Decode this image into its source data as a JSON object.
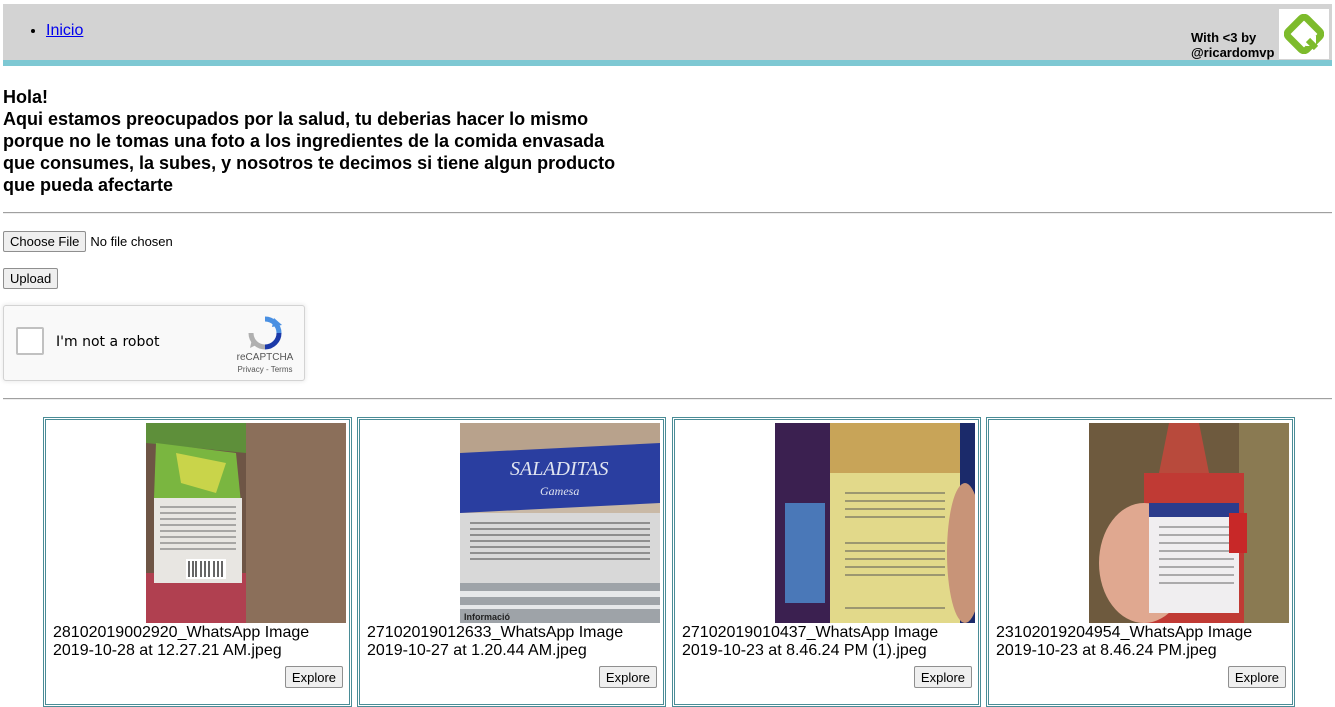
{
  "nav": {
    "home_label": "Inicio"
  },
  "credit": {
    "line1": "With <3 by",
    "line2": "@ricardomvp"
  },
  "intro": {
    "greeting": "Hola!",
    "line1": "Aqui estamos preocupados por la salud, tu deberias hacer lo mismo",
    "line2": "porque no le tomas una foto a los ingredientes de la comida envasada",
    "line3": "que consumes, la subes, y nosotros te decimos si tiene algun producto",
    "line4": "que pueda afectarte"
  },
  "upload": {
    "choose_label": "Choose File",
    "file_status": "No file chosen",
    "upload_label": "Upload"
  },
  "captcha": {
    "label": "I'm not a robot",
    "brand": "reCAPTCHA",
    "privacy": "Privacy",
    "separator": " - ",
    "terms": "Terms"
  },
  "images": [
    {
      "caption": "28102019002920_WhatsApp Image 2019-10-28 at 12.27.21 AM.jpeg",
      "button": "Explore"
    },
    {
      "caption": "27102019012633_WhatsApp Image 2019-10-27 at 1.20.44 AM.jpeg",
      "button": "Explore",
      "brand_text": "SALADITAS",
      "brand_sub": "Gamesa",
      "label_text": "Informació"
    },
    {
      "caption": "27102019010437_WhatsApp Image 2019-10-23 at 8.46.24 PM (1).jpeg",
      "button": "Explore"
    },
    {
      "caption": "23102019204954_WhatsApp Image 2019-10-23 at 8.46.24 PM.jpeg",
      "button": "Explore"
    }
  ],
  "colors": {
    "topbar": "#d3d3d3",
    "accent": "#7ec8d3",
    "card_border": "#4a8c96",
    "logo_green": "#7dbb2c"
  }
}
